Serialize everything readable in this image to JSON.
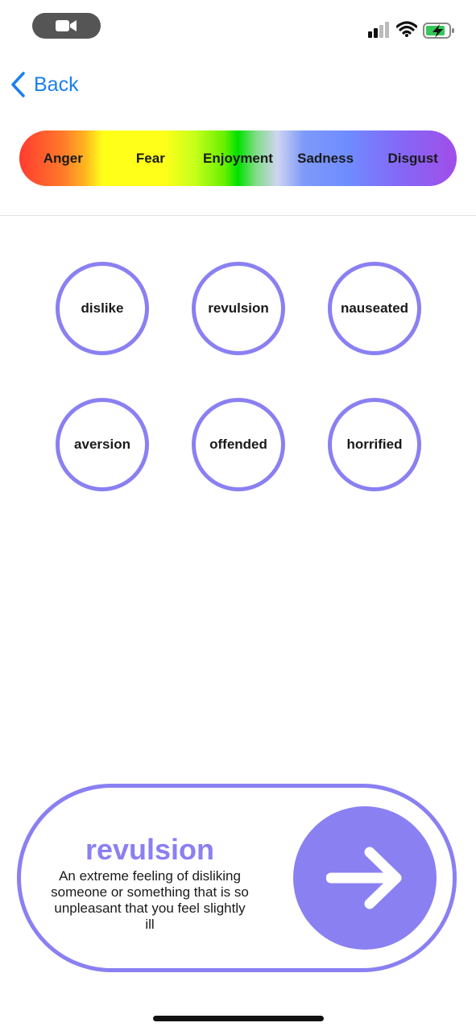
{
  "status_bar": {
    "icons": [
      "video-camera-icon",
      "cellular-signal-icon",
      "wifi-icon",
      "battery-charging-icon"
    ]
  },
  "nav": {
    "back_label": "Back"
  },
  "emotion_bar": {
    "categories": [
      "Anger",
      "Fear",
      "Enjoyment",
      "Sadness",
      "Disgust"
    ]
  },
  "words": [
    {
      "label": "dislike"
    },
    {
      "label": "revulsion"
    },
    {
      "label": "nauseated"
    },
    {
      "label": "aversion"
    },
    {
      "label": "offended"
    },
    {
      "label": "horrified"
    }
  ],
  "selected": {
    "word": "revulsion",
    "definition": "An extreme feeling of disliking someone or something that is so unpleasant that you feel slightly ill"
  },
  "colors": {
    "accent": "#8a80f2",
    "link": "#1a7ff0"
  }
}
